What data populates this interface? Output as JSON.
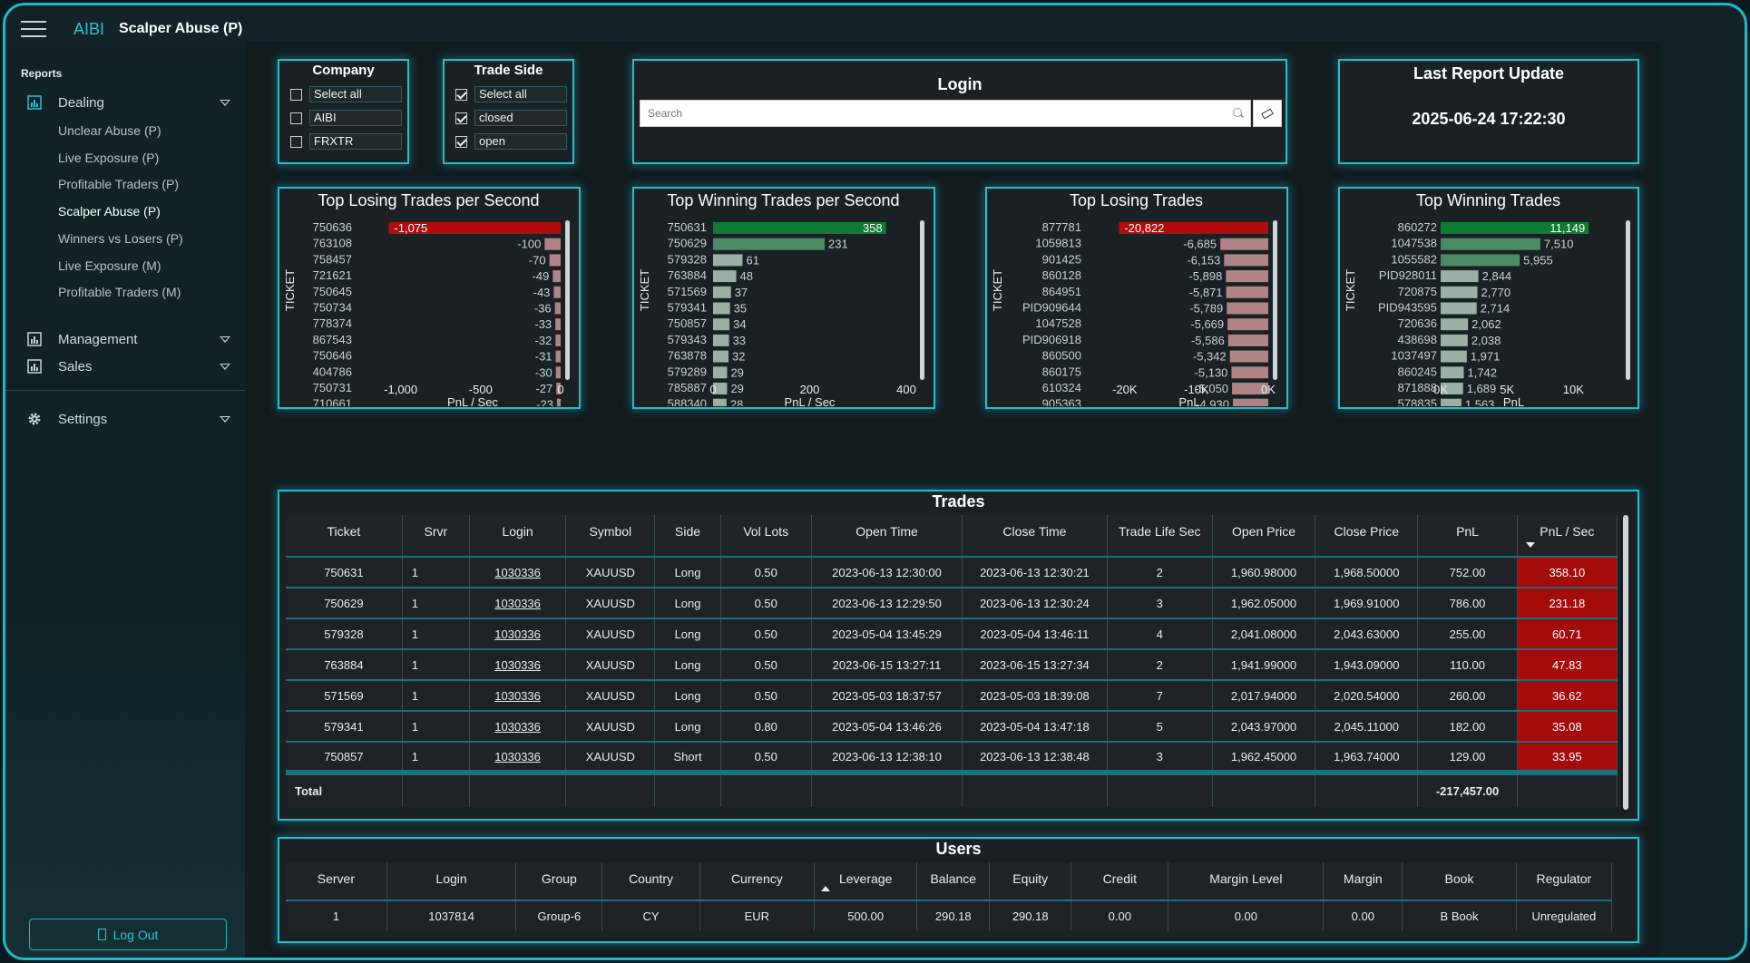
{
  "header": {
    "logo": "AIBI",
    "title": "Scalper Abuse (P)"
  },
  "sidebar": {
    "section": "Reports",
    "groups": [
      {
        "label": "Dealing",
        "icon": "bar-chart-icon"
      },
      {
        "label": "Management",
        "icon": "bar-chart-icon"
      },
      {
        "label": "Sales",
        "icon": "bar-chart-icon"
      },
      {
        "label": "Settings",
        "icon": "gear-icon"
      }
    ],
    "dealing_items": [
      "Unclear Abuse (P)",
      "Live Exposure (P)",
      "Profitable Traders (P)",
      "Scalper Abuse (P)",
      "Winners vs Losers (P)",
      "Live Exposure (M)",
      "Profitable Traders (M)"
    ],
    "active_item": "Scalper Abuse (P)",
    "logout": "Log Out"
  },
  "filters": {
    "company": {
      "title": "Company",
      "options": [
        {
          "label": "Select all",
          "checked": false
        },
        {
          "label": "AIBI",
          "checked": false
        },
        {
          "label": "FRXTR",
          "checked": false
        }
      ]
    },
    "trade_side": {
      "title": "Trade Side",
      "options": [
        {
          "label": "Select all",
          "checked": true
        },
        {
          "label": "closed",
          "checked": true
        },
        {
          "label": "open",
          "checked": true
        }
      ]
    },
    "login": {
      "title": "Login",
      "placeholder": "Search"
    },
    "last_update": {
      "title": "Last Report Update",
      "value": "2025-06-24 17:22:30"
    }
  },
  "chart_data": [
    {
      "type": "bar",
      "title": "Top Losing Trades per Second",
      "ylabel": "TICKET",
      "xlabel": "PnL / Sec",
      "categories": [
        "750636",
        "763108",
        "758457",
        "721621",
        "750645",
        "750734",
        "778374",
        "867543",
        "750646",
        "404786",
        "750731",
        "710661"
      ],
      "values": [
        -1075,
        -100,
        -70,
        -49,
        -43,
        -36,
        -33,
        -32,
        -31,
        -30,
        -27,
        -23
      ],
      "labels": [
        "-1,075",
        "-100",
        "-70",
        "-49",
        "-43",
        "-36",
        "-33",
        "-32",
        "-31",
        "-30",
        "-27",
        "-23"
      ],
      "ticks": [
        "-1,000",
        "-500",
        "0"
      ],
      "xlim": [
        -1100,
        0
      ]
    },
    {
      "type": "bar",
      "title": "Top Winning Trades per Second",
      "ylabel": "TICKET",
      "xlabel": "PnL / Sec",
      "categories": [
        "750631",
        "750629",
        "579328",
        "763884",
        "571569",
        "579341",
        "750857",
        "579343",
        "763878",
        "579289",
        "785887",
        "588340"
      ],
      "values": [
        358,
        231,
        61,
        48,
        37,
        35,
        34,
        33,
        32,
        29,
        29,
        28
      ],
      "labels": [
        "358",
        "231",
        "61",
        "48",
        "37",
        "35",
        "34",
        "33",
        "32",
        "29",
        "29",
        "28"
      ],
      "ticks": [
        "0",
        "200",
        "400"
      ],
      "xlim": [
        0,
        400
      ]
    },
    {
      "type": "bar",
      "title": "Top Losing Trades",
      "ylabel": "TICKET",
      "xlabel": "PnL",
      "categories": [
        "877781",
        "1059813",
        "901425",
        "860128",
        "864951",
        "PID909644",
        "1047528",
        "PID906918",
        "860500",
        "860175",
        "610324",
        "905363"
      ],
      "values": [
        -20822,
        -6685,
        -6153,
        -5898,
        -5871,
        -5789,
        -5669,
        -5586,
        -5342,
        -5130,
        -5050,
        -4930
      ],
      "labels": [
        "-20,822",
        "-6,685",
        "-6,153",
        "-5,898",
        "-5,871",
        "-5,789",
        "-5,669",
        "-5,586",
        "-5,342",
        "-5,130",
        "-5,050",
        "-4,930"
      ],
      "ticks": [
        "-20K",
        "-10K",
        "0K"
      ],
      "xlim": [
        -22000,
        0
      ]
    },
    {
      "type": "bar",
      "title": "Top Winning Trades",
      "ylabel": "TICKET",
      "xlabel": "PnL",
      "categories": [
        "860272",
        "1047538",
        "1055582",
        "PID928011",
        "720875",
        "PID943595",
        "720636",
        "438698",
        "1037497",
        "860245",
        "871888",
        "578835"
      ],
      "values": [
        11149,
        7510,
        5955,
        2844,
        2770,
        2714,
        2062,
        2038,
        1971,
        1742,
        1689,
        1563
      ],
      "labels": [
        "11,149",
        "7,510",
        "5,955",
        "2,844",
        "2,770",
        "2,714",
        "2,062",
        "2,038",
        "1,971",
        "1,742",
        "1,689",
        "1,563"
      ],
      "ticks": [
        "0K",
        "5K",
        "10K"
      ],
      "xlim": [
        0,
        11000
      ]
    }
  ],
  "trades": {
    "title": "Trades",
    "columns": [
      "Ticket",
      "Srvr",
      "Login",
      "Symbol",
      "Side",
      "Vol Lots",
      "Open Time",
      "Close Time",
      "Trade Life Sec",
      "Open Price",
      "Close Price",
      "PnL",
      "PnL / Sec"
    ],
    "rows": [
      [
        "750631",
        "1",
        "1030336",
        "XAUUSD",
        "Long",
        "0.50",
        "2023-06-13 12:30:00",
        "2023-06-13 12:30:21",
        "2",
        "1,960.98000",
        "1,968.50000",
        "752.00",
        "358.10"
      ],
      [
        "750629",
        "1",
        "1030336",
        "XAUUSD",
        "Long",
        "0.50",
        "2023-06-13 12:29:50",
        "2023-06-13 12:30:24",
        "3",
        "1,962.05000",
        "1,969.91000",
        "786.00",
        "231.18"
      ],
      [
        "579328",
        "1",
        "1030336",
        "XAUUSD",
        "Long",
        "0.50",
        "2023-05-04 13:45:29",
        "2023-05-04 13:46:11",
        "4",
        "2,041.08000",
        "2,043.63000",
        "255.00",
        "60.71"
      ],
      [
        "763884",
        "1",
        "1030336",
        "XAUUSD",
        "Long",
        "0.50",
        "2023-06-15 13:27:11",
        "2023-06-15 13:27:34",
        "2",
        "1,941.99000",
        "1,943.09000",
        "110.00",
        "47.83"
      ],
      [
        "571569",
        "1",
        "1030336",
        "XAUUSD",
        "Long",
        "0.50",
        "2023-05-03 18:37:57",
        "2023-05-03 18:39:08",
        "7",
        "2,017.94000",
        "2,020.54000",
        "260.00",
        "36.62"
      ],
      [
        "579341",
        "1",
        "1030336",
        "XAUUSD",
        "Long",
        "0.80",
        "2023-05-04 13:46:26",
        "2023-05-04 13:47:18",
        "5",
        "2,043.97000",
        "2,045.11000",
        "182.00",
        "35.08"
      ],
      [
        "750857",
        "1",
        "1030336",
        "XAUUSD",
        "Short",
        "0.50",
        "2023-06-13 12:38:10",
        "2023-06-13 12:38:48",
        "3",
        "1,962.45000",
        "1,963.74000",
        "129.00",
        "33.95"
      ]
    ],
    "total_label": "Total",
    "total_pnl": "-217,457.00"
  },
  "users": {
    "title": "Users",
    "columns": [
      "Server",
      "Login",
      "Group",
      "Country",
      "Currency",
      "Leverage",
      "Balance",
      "Equity",
      "Credit",
      "Margin Level",
      "Margin",
      "Book",
      "Regulator"
    ],
    "rows": [
      [
        "1",
        "1037814",
        "Group-6",
        "CY",
        "EUR",
        "500.00",
        "290.18",
        "290.18",
        "0.00",
        "0.00",
        "0.00",
        "B Book",
        "Unregulated"
      ]
    ]
  },
  "colors": {
    "accent": "#21c0d0",
    "loss_bar": "#b08484",
    "loss_top": "#b00c0c",
    "win_bar": "#9ab0a4",
    "win_top": "#0f7a34",
    "win_second": "#4a8c64"
  }
}
